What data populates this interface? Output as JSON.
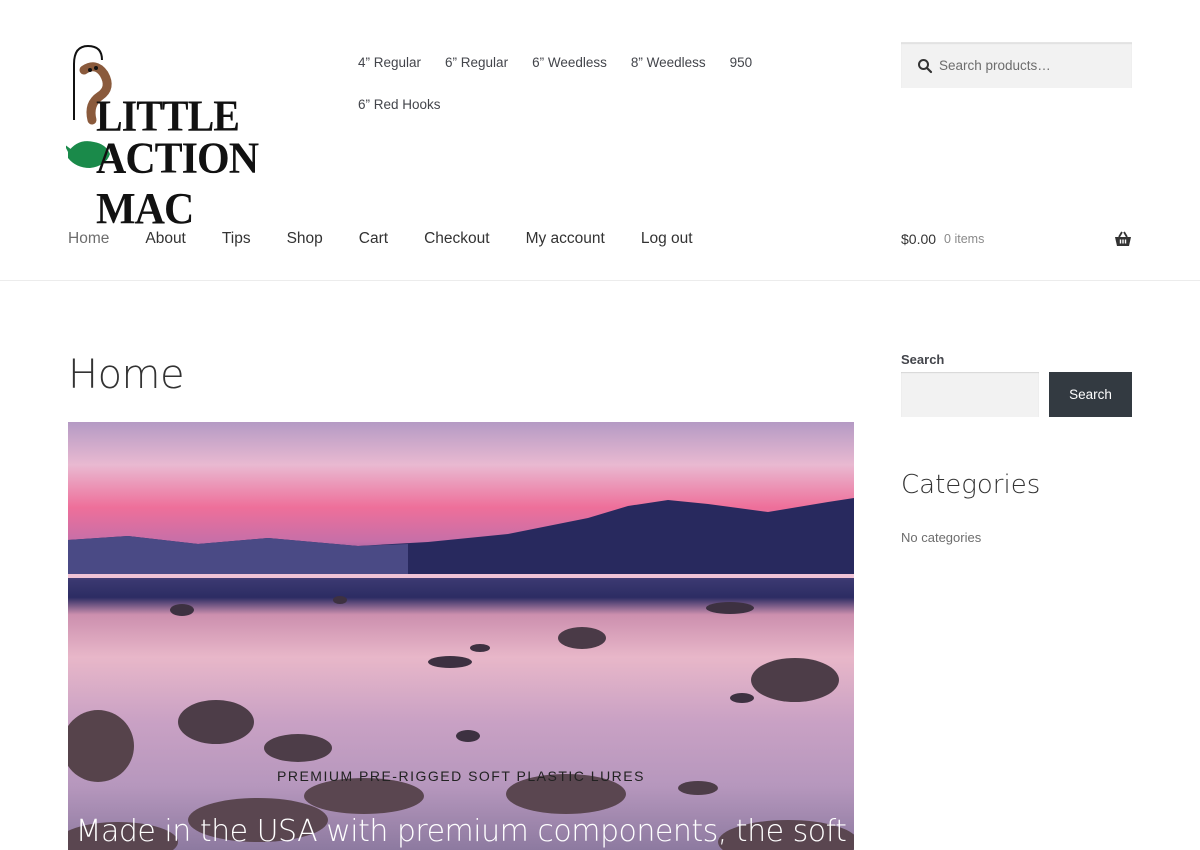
{
  "brand": {
    "logo_line1": "LITTLE",
    "logo_line2": "ACTION MAC"
  },
  "secondary_nav": [
    {
      "label": "4” Regular"
    },
    {
      "label": "6” Regular"
    },
    {
      "label": "6” Weedless"
    },
    {
      "label": "8” Weedless"
    },
    {
      "label": "950"
    },
    {
      "label": "6” Red Hooks"
    }
  ],
  "header_search": {
    "placeholder": "Search products…"
  },
  "primary_nav": [
    {
      "label": "Home"
    },
    {
      "label": "About"
    },
    {
      "label": "Tips"
    },
    {
      "label": "Shop"
    },
    {
      "label": "Cart"
    },
    {
      "label": "Checkout"
    },
    {
      "label": "My account"
    },
    {
      "label": "Log out"
    }
  ],
  "cart": {
    "amount": "$0.00",
    "count": "0 items"
  },
  "page": {
    "title": "Home"
  },
  "hero": {
    "tagline": "PREMIUM PRE-RIGGED SOFT PLASTIC LURES",
    "headline": "Made in the USA with premium components, the soft"
  },
  "sidebar": {
    "search_label": "Search",
    "search_button": "Search",
    "categories_title": "Categories",
    "categories_empty": "No categories"
  },
  "colors": {
    "button_bg": "#333a41",
    "logo_green": "#1a8a4a",
    "worm_brown": "#8a5a3c"
  }
}
